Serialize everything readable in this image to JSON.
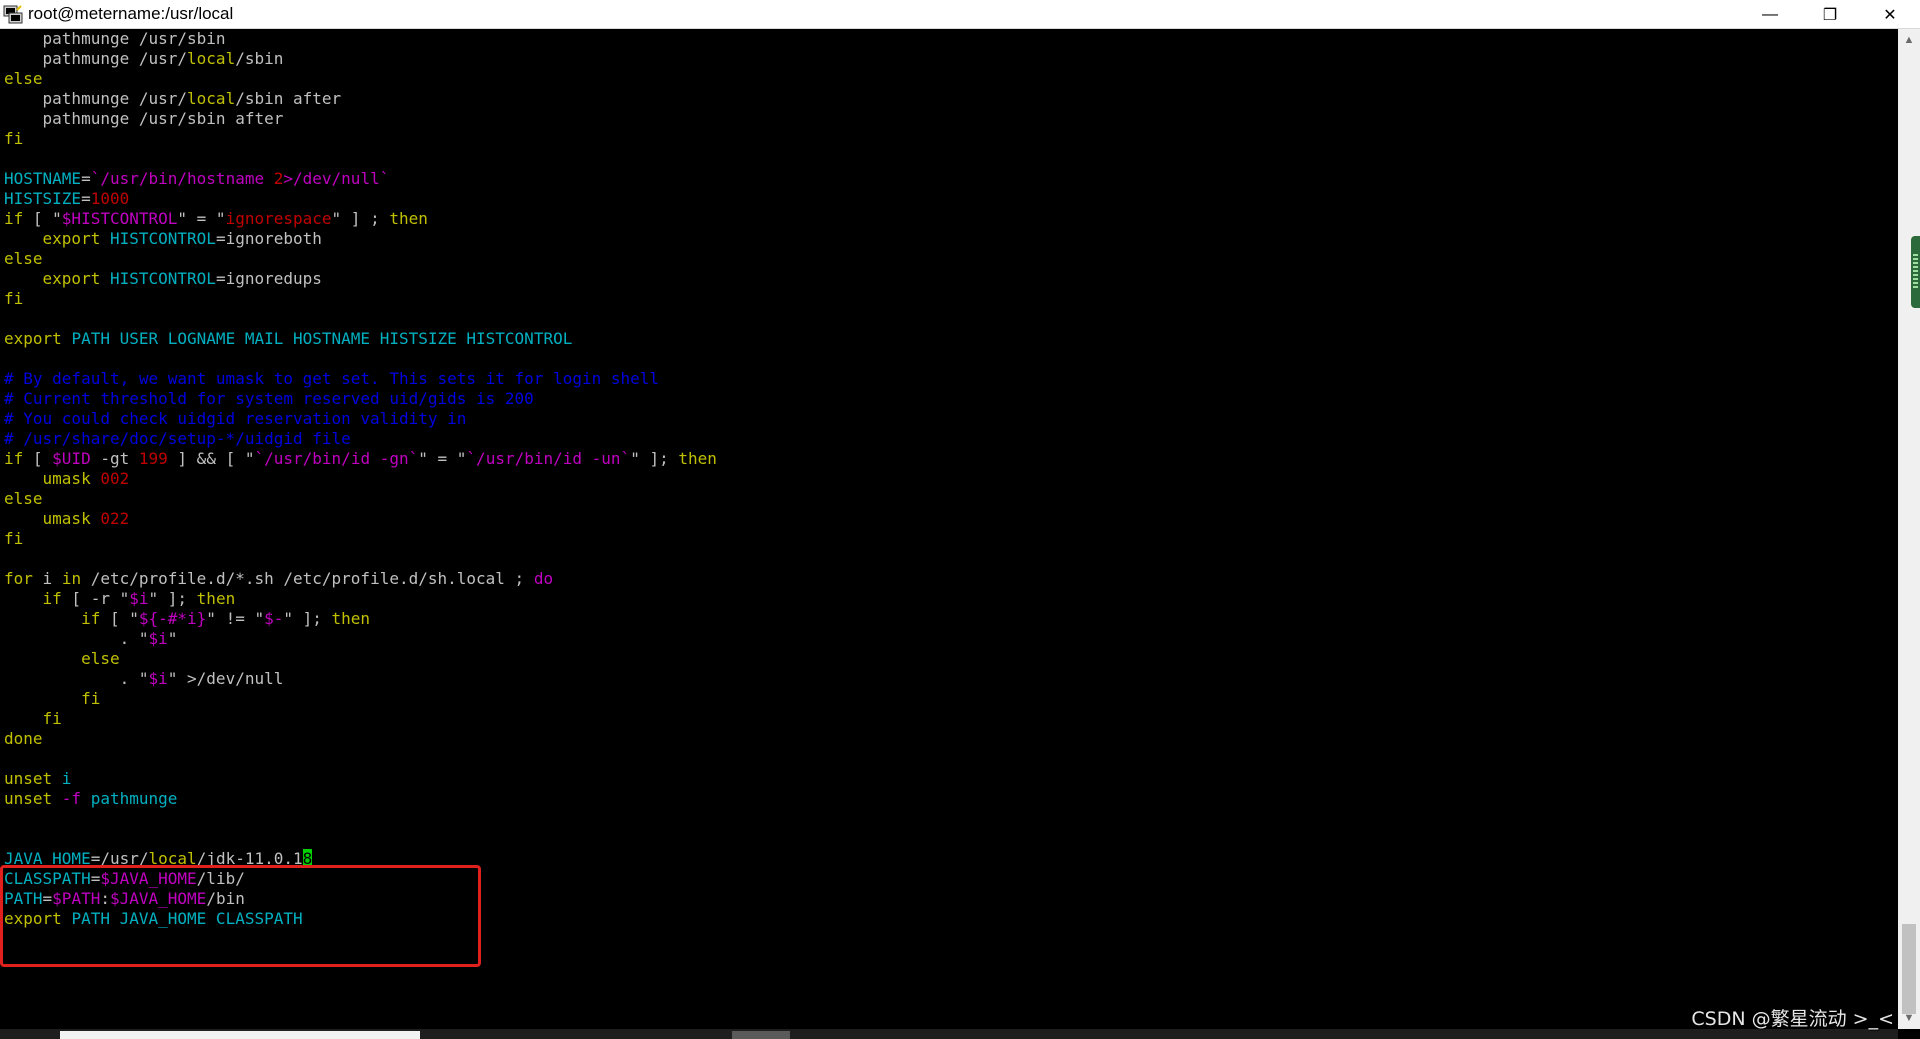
{
  "window": {
    "title": "root@metername:/usr/local",
    "minimize_glyph": "—",
    "restore_glyph": "❐",
    "close_glyph": "✕",
    "icon": "putty-terminal-icon"
  },
  "terminal": {
    "lines": [
      [
        {
          "t": "    pathmunge /usr/sbin",
          "c": "#c0c0c0"
        }
      ],
      [
        {
          "t": "    pathmunge /usr/",
          "c": "#c0c0c0"
        },
        {
          "t": "local",
          "c": "#c0c000"
        },
        {
          "t": "/sbin",
          "c": "#c0c0c0"
        }
      ],
      [
        {
          "t": "else",
          "c": "#c0c000"
        }
      ],
      [
        {
          "t": "    pathmunge /usr/",
          "c": "#c0c0c0"
        },
        {
          "t": "local",
          "c": "#c0c000"
        },
        {
          "t": "/sbin after",
          "c": "#c0c0c0"
        }
      ],
      [
        {
          "t": "    pathmunge /usr/sbin after",
          "c": "#c0c0c0"
        }
      ],
      [
        {
          "t": "fi",
          "c": "#c0c000"
        }
      ],
      [],
      [
        {
          "t": "HOSTNAME",
          "c": "#00b0c0"
        },
        {
          "t": "=",
          "c": "#c0c0c0"
        },
        {
          "t": "`/usr/bin/hostname ",
          "c": "#c000c0"
        },
        {
          "t": "2",
          "c": "#c00000"
        },
        {
          "t": ">/dev/null`",
          "c": "#c000c0"
        }
      ],
      [
        {
          "t": "HISTSIZE",
          "c": "#00b0c0"
        },
        {
          "t": "=",
          "c": "#c0c0c0"
        },
        {
          "t": "1000",
          "c": "#c00000"
        }
      ],
      [
        {
          "t": "if",
          "c": "#c0c000"
        },
        {
          "t": " [ \"",
          "c": "#c0c0c0"
        },
        {
          "t": "$HISTCONTROL",
          "c": "#c000c0"
        },
        {
          "t": "\" = \"",
          "c": "#c0c0c0"
        },
        {
          "t": "ignorespace",
          "c": "#c00000"
        },
        {
          "t": "\" ] ; ",
          "c": "#c0c0c0"
        },
        {
          "t": "then",
          "c": "#c0c000"
        }
      ],
      [
        {
          "t": "    export ",
          "c": "#c0c000"
        },
        {
          "t": "HISTCONTROL",
          "c": "#00b0c0"
        },
        {
          "t": "=ignoreboth",
          "c": "#c0c0c0"
        }
      ],
      [
        {
          "t": "else",
          "c": "#c0c000"
        }
      ],
      [
        {
          "t": "    export ",
          "c": "#c0c000"
        },
        {
          "t": "HISTCONTROL",
          "c": "#00b0c0"
        },
        {
          "t": "=ignoredups",
          "c": "#c0c0c0"
        }
      ],
      [
        {
          "t": "fi",
          "c": "#c0c000"
        }
      ],
      [],
      [
        {
          "t": "export ",
          "c": "#c0c000"
        },
        {
          "t": "PATH USER LOGNAME MAIL HOSTNAME HISTSIZE HISTCONTROL",
          "c": "#00b0c0"
        }
      ],
      [],
      [
        {
          "t": "# By default, we want umask to get set. This sets it for login shell",
          "c": "#0000e0"
        }
      ],
      [
        {
          "t": "# Current threshold for system reserved uid/gids is 200",
          "c": "#0000e0"
        }
      ],
      [
        {
          "t": "# You could check uidgid reservation validity in",
          "c": "#0000e0"
        }
      ],
      [
        {
          "t": "# /usr/share/doc/setup-*/uidgid file",
          "c": "#0000e0"
        }
      ],
      [
        {
          "t": "if",
          "c": "#c0c000"
        },
        {
          "t": " [ ",
          "c": "#c0c0c0"
        },
        {
          "t": "$UID",
          "c": "#c000c0"
        },
        {
          "t": " -gt ",
          "c": "#c0c0c0"
        },
        {
          "t": "199",
          "c": "#c00000"
        },
        {
          "t": " ] && [ \"",
          "c": "#c0c0c0"
        },
        {
          "t": "`/usr/bin/id -gn`",
          "c": "#c000c0"
        },
        {
          "t": "\" = \"",
          "c": "#c0c0c0"
        },
        {
          "t": "`/usr/bin/id -un`",
          "c": "#c000c0"
        },
        {
          "t": "\" ]; ",
          "c": "#c0c0c0"
        },
        {
          "t": "then",
          "c": "#c0c000"
        }
      ],
      [
        {
          "t": "    umask ",
          "c": "#c0c000"
        },
        {
          "t": "002",
          "c": "#c00000"
        }
      ],
      [
        {
          "t": "else",
          "c": "#c0c000"
        }
      ],
      [
        {
          "t": "    umask ",
          "c": "#c0c000"
        },
        {
          "t": "022",
          "c": "#c00000"
        }
      ],
      [
        {
          "t": "fi",
          "c": "#c0c000"
        }
      ],
      [],
      [
        {
          "t": "for",
          "c": "#c0c000"
        },
        {
          "t": " i ",
          "c": "#c0c0c0"
        },
        {
          "t": "in",
          "c": "#c0c000"
        },
        {
          "t": " /etc/profile.d/*.sh /etc/profile.d/sh.local ; ",
          "c": "#c0c0c0"
        },
        {
          "t": "do",
          "c": "#c000c0"
        }
      ],
      [
        {
          "t": "    if",
          "c": "#c0c000"
        },
        {
          "t": " [ -r \"",
          "c": "#c0c0c0"
        },
        {
          "t": "$i",
          "c": "#c000c0"
        },
        {
          "t": "\" ]; ",
          "c": "#c0c0c0"
        },
        {
          "t": "then",
          "c": "#c0c000"
        }
      ],
      [
        {
          "t": "        if",
          "c": "#c0c000"
        },
        {
          "t": " [ \"",
          "c": "#c0c0c0"
        },
        {
          "t": "${-#*i}",
          "c": "#c000c0"
        },
        {
          "t": "\" != \"",
          "c": "#c0c0c0"
        },
        {
          "t": "$-",
          "c": "#c000c0"
        },
        {
          "t": "\" ]; ",
          "c": "#c0c0c0"
        },
        {
          "t": "then",
          "c": "#c0c000"
        }
      ],
      [
        {
          "t": "            . \"",
          "c": "#c0c0c0"
        },
        {
          "t": "$i",
          "c": "#c000c0"
        },
        {
          "t": "\"",
          "c": "#c0c0c0"
        }
      ],
      [
        {
          "t": "        else",
          "c": "#c0c000"
        }
      ],
      [
        {
          "t": "            . \"",
          "c": "#c0c0c0"
        },
        {
          "t": "$i",
          "c": "#c000c0"
        },
        {
          "t": "\" >/dev/null",
          "c": "#c0c0c0"
        }
      ],
      [
        {
          "t": "        fi",
          "c": "#c0c000"
        }
      ],
      [
        {
          "t": "    fi",
          "c": "#c0c000"
        }
      ],
      [
        {
          "t": "done",
          "c": "#c0c000"
        }
      ],
      [],
      [
        {
          "t": "unset ",
          "c": "#c0c000"
        },
        {
          "t": "i",
          "c": "#00b0c0"
        }
      ],
      [
        {
          "t": "unset ",
          "c": "#c0c000"
        },
        {
          "t": "-f ",
          "c": "#c000c0"
        },
        {
          "t": "pathmunge",
          "c": "#00b0c0"
        }
      ],
      [],
      [],
      [
        {
          "t": "JAVA_HOME",
          "c": "#00b0c0"
        },
        {
          "t": "=/usr/",
          "c": "#c0c0c0"
        },
        {
          "t": "local",
          "c": "#c0c000"
        },
        {
          "t": "/jdk-11.0.1",
          "c": "#c0c0c0"
        },
        {
          "t": "8",
          "c": "#000000",
          "cursor": true
        }
      ],
      [
        {
          "t": "CLASSPATH",
          "c": "#00b0c0"
        },
        {
          "t": "=",
          "c": "#c0c0c0"
        },
        {
          "t": "$JAVA_HOME",
          "c": "#c000c0"
        },
        {
          "t": "/lib/",
          "c": "#c0c0c0"
        }
      ],
      [
        {
          "t": "PATH",
          "c": "#00b0c0"
        },
        {
          "t": "=",
          "c": "#c0c0c0"
        },
        {
          "t": "$PATH",
          "c": "#c000c0"
        },
        {
          "t": ":",
          "c": "#c0c0c0"
        },
        {
          "t": "$JAVA_HOME",
          "c": "#c000c0"
        },
        {
          "t": "/bin",
          "c": "#c0c0c0"
        }
      ],
      [
        {
          "t": "export ",
          "c": "#c0c000"
        },
        {
          "t": "PATH JAVA_HOME CLASSPATH",
          "c": "#00b0c0"
        }
      ]
    ]
  },
  "scrollbar": {
    "up_glyph": "▲",
    "down_glyph": "▼"
  },
  "watermark": "CSDN @繁星流动 >_<",
  "colors": {
    "background": "#000000",
    "highlight_box": "#e0201c",
    "cursor": "#00d000"
  }
}
